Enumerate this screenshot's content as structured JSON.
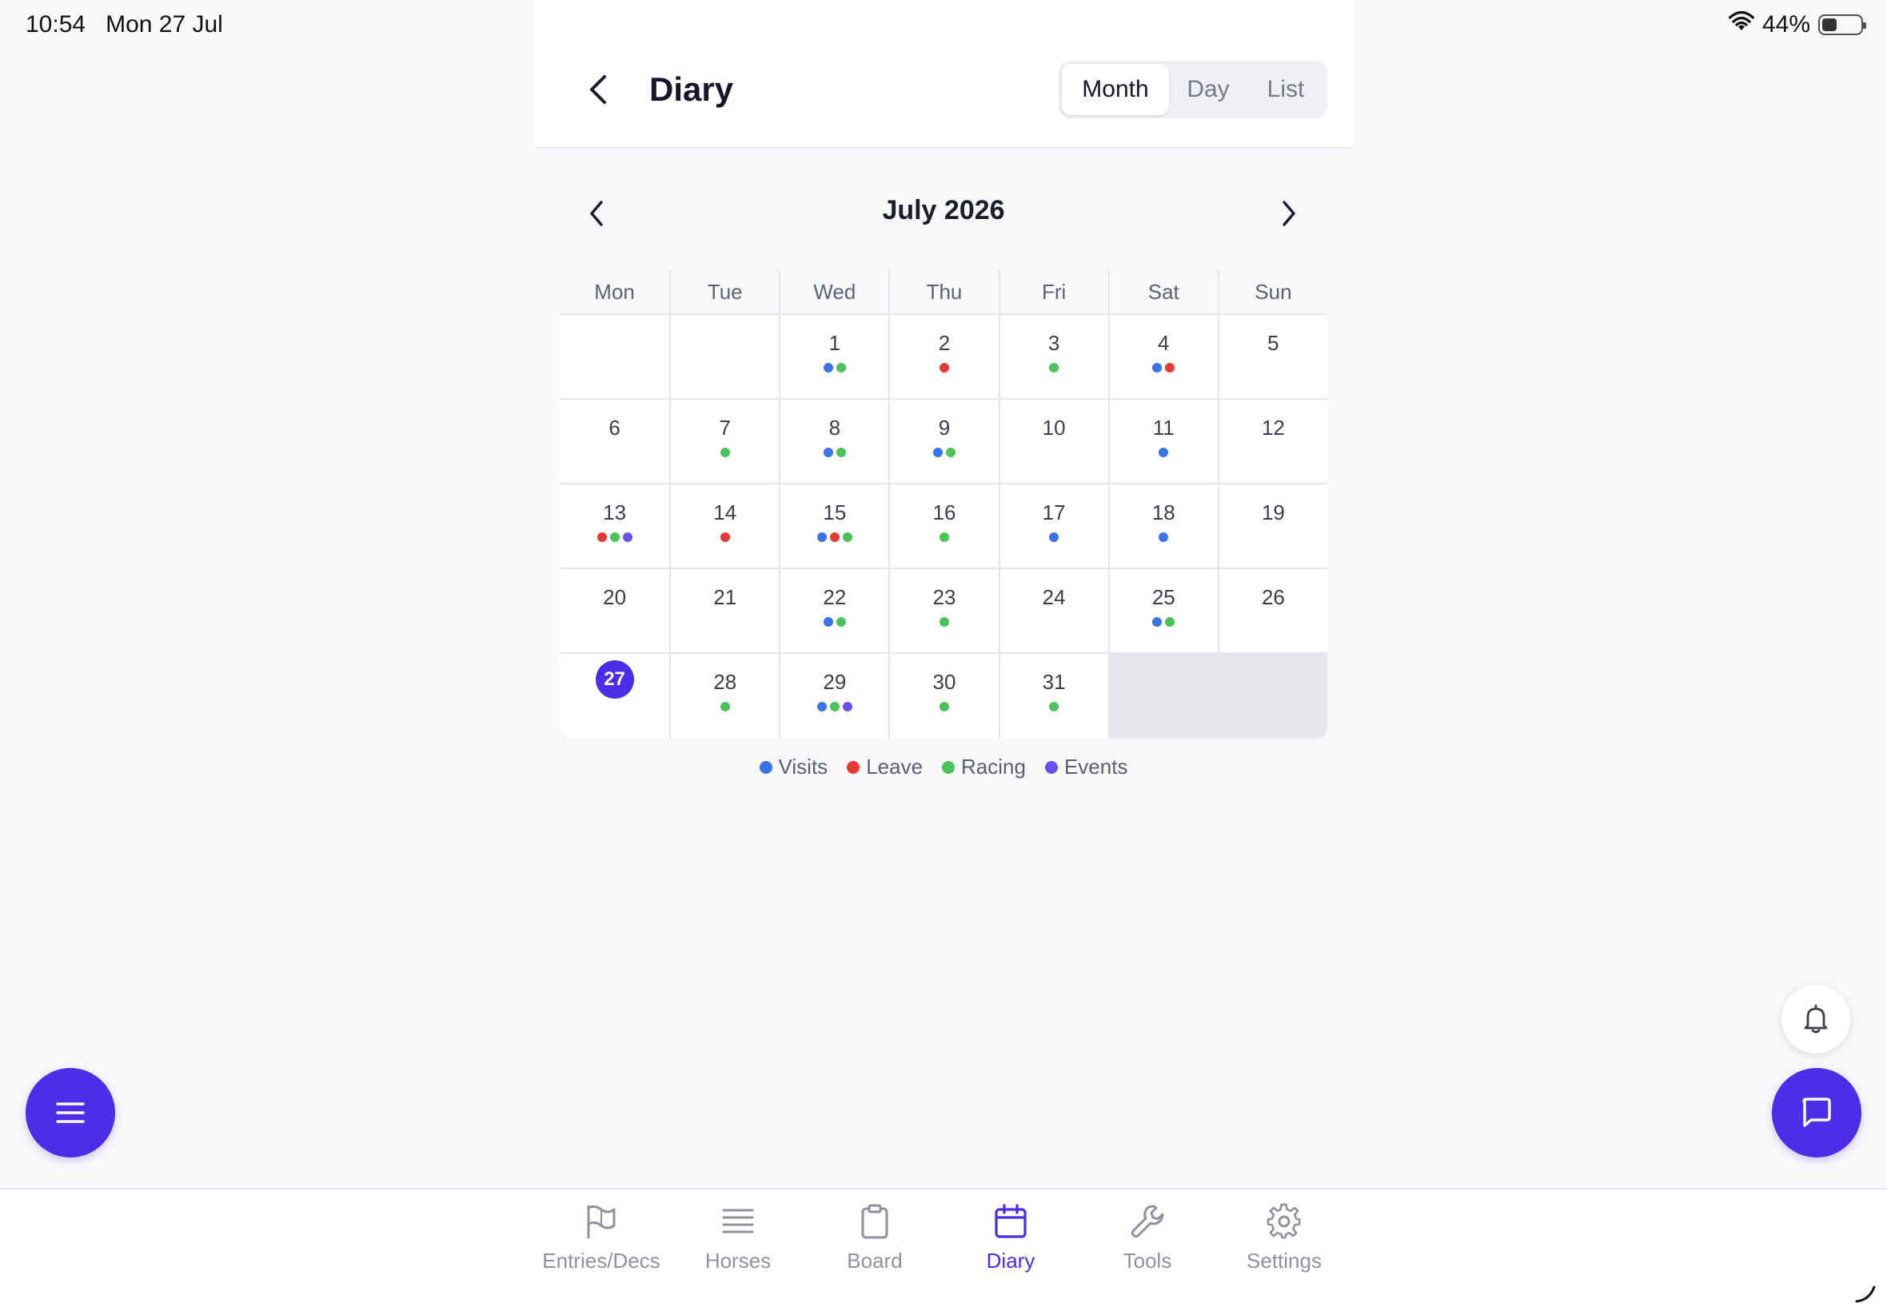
{
  "status_bar": {
    "time": "10:54",
    "date": "Mon 27 Jul",
    "battery": "44%"
  },
  "header": {
    "title": "Diary",
    "view_options": [
      {
        "label": "Month",
        "active": true
      },
      {
        "label": "Day",
        "active": false
      },
      {
        "label": "List",
        "active": false
      }
    ]
  },
  "calendar": {
    "month_label": "July 2026",
    "weekdays": [
      "Mon",
      "Tue",
      "Wed",
      "Thu",
      "Fri",
      "Sat",
      "Sun"
    ],
    "today": 27,
    "leading_blanks": 2,
    "days": [
      {
        "day": 1,
        "dots": [
          "visits",
          "racing"
        ]
      },
      {
        "day": 2,
        "dots": [
          "leave"
        ]
      },
      {
        "day": 3,
        "dots": [
          "racing"
        ]
      },
      {
        "day": 4,
        "dots": [
          "visits",
          "leave"
        ]
      },
      {
        "day": 5,
        "dots": []
      },
      {
        "day": 6,
        "dots": []
      },
      {
        "day": 7,
        "dots": [
          "racing"
        ]
      },
      {
        "day": 8,
        "dots": [
          "visits",
          "racing"
        ]
      },
      {
        "day": 9,
        "dots": [
          "visits",
          "racing"
        ]
      },
      {
        "day": 10,
        "dots": []
      },
      {
        "day": 11,
        "dots": [
          "visits"
        ]
      },
      {
        "day": 12,
        "dots": []
      },
      {
        "day": 13,
        "dots": [
          "leave",
          "racing",
          "events"
        ]
      },
      {
        "day": 14,
        "dots": [
          "leave"
        ]
      },
      {
        "day": 15,
        "dots": [
          "visits",
          "leave",
          "racing"
        ]
      },
      {
        "day": 16,
        "dots": [
          "racing"
        ]
      },
      {
        "day": 17,
        "dots": [
          "visits"
        ]
      },
      {
        "day": 18,
        "dots": [
          "visits"
        ]
      },
      {
        "day": 19,
        "dots": []
      },
      {
        "day": 20,
        "dots": []
      },
      {
        "day": 21,
        "dots": []
      },
      {
        "day": 22,
        "dots": [
          "visits",
          "racing"
        ]
      },
      {
        "day": 23,
        "dots": [
          "racing"
        ]
      },
      {
        "day": 24,
        "dots": []
      },
      {
        "day": 25,
        "dots": [
          "visits",
          "racing"
        ]
      },
      {
        "day": 26,
        "dots": []
      },
      {
        "day": 27,
        "dots": []
      },
      {
        "day": 28,
        "dots": [
          "racing"
        ]
      },
      {
        "day": 29,
        "dots": [
          "visits",
          "racing",
          "events"
        ]
      },
      {
        "day": 30,
        "dots": [
          "racing"
        ]
      },
      {
        "day": 31,
        "dots": [
          "racing"
        ]
      }
    ],
    "trailing_blanks": 2
  },
  "legend": [
    {
      "key": "visits",
      "label": "Visits",
      "color": "#3b73e8"
    },
    {
      "key": "leave",
      "label": "Leave",
      "color": "#e53935"
    },
    {
      "key": "racing",
      "label": "Racing",
      "color": "#4cc35a"
    },
    {
      "key": "events",
      "label": "Events",
      "color": "#6a4ff0"
    }
  ],
  "tabs": [
    {
      "label": "Entries/Decs",
      "icon": "flag-icon",
      "active": false
    },
    {
      "label": "Horses",
      "icon": "list-icon",
      "active": false
    },
    {
      "label": "Board",
      "icon": "clipboard-icon",
      "active": false
    },
    {
      "label": "Diary",
      "icon": "calendar-icon",
      "active": true
    },
    {
      "label": "Tools",
      "icon": "wrench-icon",
      "active": false
    },
    {
      "label": "Settings",
      "icon": "gear-icon",
      "active": false
    }
  ],
  "colors": {
    "accent": "#4b2ee8",
    "inactive": "#8d929c"
  }
}
